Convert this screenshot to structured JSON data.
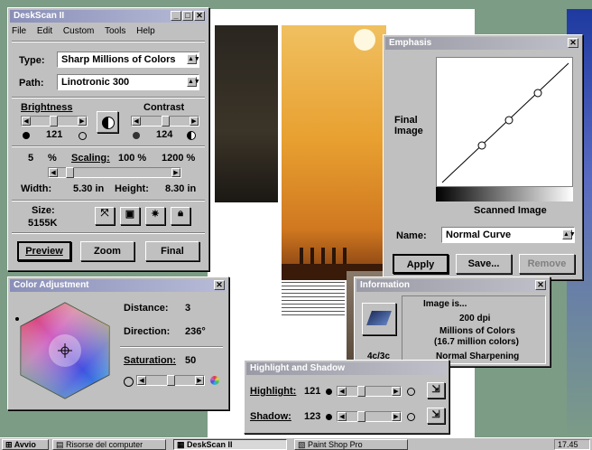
{
  "deskscan": {
    "title": "DeskScan II",
    "menu": [
      "File",
      "Edit",
      "Custom",
      "Tools",
      "Help"
    ],
    "type_label": "Type:",
    "type_value": "Sharp Millions of Colors",
    "path_label": "Path:",
    "path_value": "Linotronic 300",
    "brightness_label": "Brightness",
    "brightness_value": "121",
    "contrast_label": "Contrast",
    "contrast_value": "124",
    "pct_min": "5",
    "pct_sign": "%",
    "scaling_label": "Scaling:",
    "scaling_value": "100 %",
    "pct_max": "1200 %",
    "width_label": "Width:",
    "width_value": "5.30 in",
    "height_label": "Height:",
    "height_value": "8.30 in",
    "size_label": "Size:",
    "size_value": "5155K",
    "preview_label": "Preview",
    "zoom_label": "Zoom",
    "final_label": "Final"
  },
  "emphasis": {
    "title": "Emphasis",
    "final_image_label": "Final Image",
    "scanned_image_label": "Scanned Image",
    "name_label": "Name:",
    "name_value": "Normal Curve",
    "apply_label": "Apply",
    "save_label": "Save...",
    "remove_label": "Remove"
  },
  "color_adjustment": {
    "title": "Color Adjustment",
    "distance_label": "Distance:",
    "distance_value": "3",
    "direction_label": "Direction:",
    "direction_value": "236°",
    "saturation_label": "Saturation:",
    "saturation_value": "50"
  },
  "information": {
    "title": "Information",
    "image_is": "Image is...",
    "dpi": "200 dpi",
    "colors": "Millions of Colors",
    "colors_detail": "(16.7 million colors)",
    "sharpening": "Normal Sharpening",
    "code": "4c/3c"
  },
  "highlight_shadow": {
    "title": "Highlight and Shadow",
    "highlight_label": "Highlight:",
    "highlight_value": "121",
    "shadow_label": "Shadow:",
    "shadow_value": "123"
  },
  "taskbar": {
    "start_label": "Avvio",
    "items": [
      "Risorse del computer",
      "DeskScan II",
      "Paint Shop Pro"
    ],
    "clock": "17.45"
  },
  "colors": {
    "desktop": "#7c9c86",
    "title_active": "#8a8fb8",
    "title_inactive": "#9a9aa6",
    "window_face": "#c0c0c0",
    "preview_sunset": "#e8a030"
  },
  "slider_levels": {
    "brightness": 0.48,
    "contrast": 0.5,
    "scaling": 0.08,
    "saturation": 0.5,
    "highlight": 0.3,
    "shadow": 0.3
  }
}
